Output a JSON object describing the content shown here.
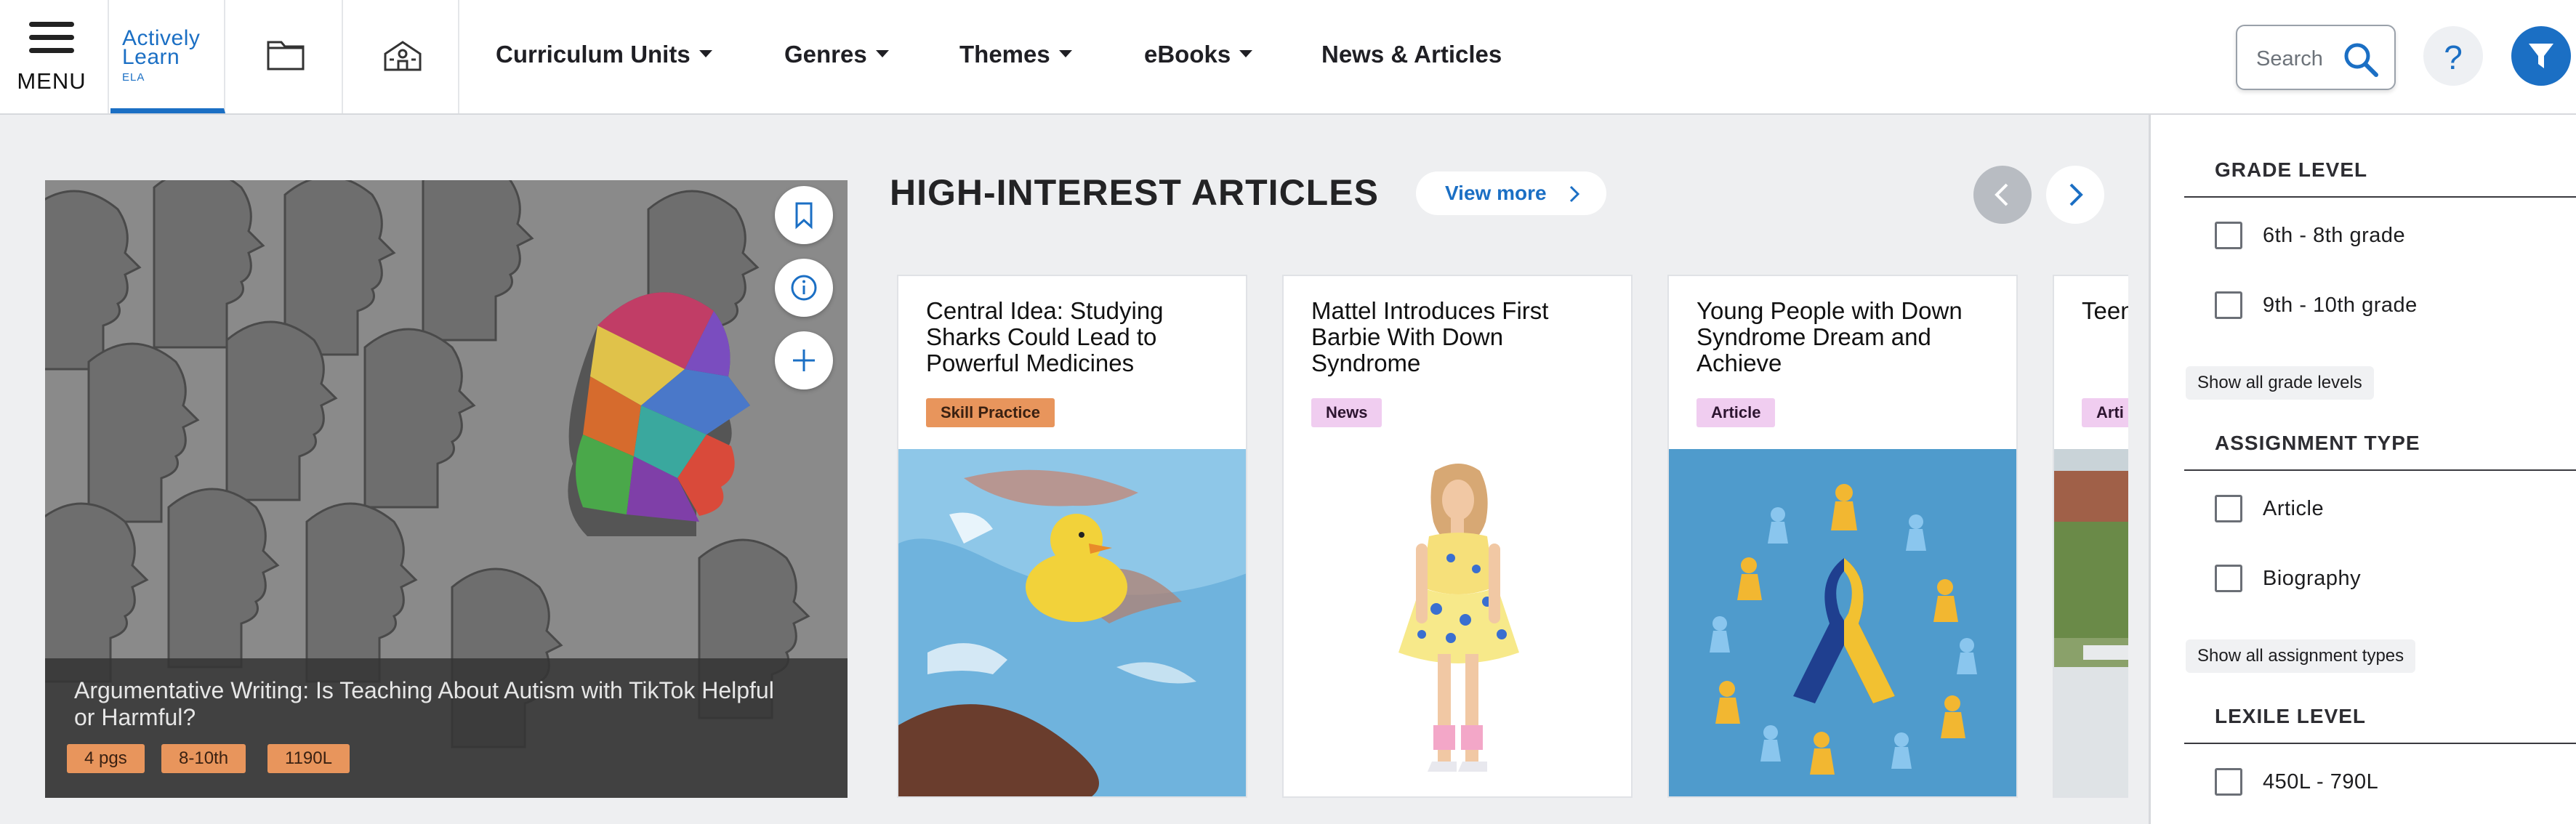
{
  "header": {
    "menu_label": "MENU",
    "logo": {
      "line1": "Actively",
      "line2": "Learn",
      "line3": "ELA"
    },
    "nav": [
      {
        "label": "Curriculum Units",
        "has_dropdown": true
      },
      {
        "label": "Genres",
        "has_dropdown": true
      },
      {
        "label": "Themes",
        "has_dropdown": true
      },
      {
        "label": "eBooks",
        "has_dropdown": true
      },
      {
        "label": "News & Articles",
        "has_dropdown": false
      }
    ],
    "search": {
      "placeholder": "Search",
      "value": ""
    },
    "help_label": "?",
    "icons": {
      "library": "folder-icon",
      "school": "school-icon",
      "search": "search-icon",
      "filter": "filter-icon"
    }
  },
  "featured": {
    "title": "Argumentative Writing: Is Teaching About Autism with TikTok Helpful or Harmful?",
    "tags": [
      "4 pgs",
      "8-10th",
      "1190L"
    ],
    "actions": [
      "bookmark-icon",
      "info-icon",
      "add-icon"
    ]
  },
  "section": {
    "title": "HIGH-INTEREST ARTICLES",
    "view_more": "View more"
  },
  "cards": [
    {
      "title": "Central Idea: Studying Sharks Could Lead to Powerful Medicines",
      "tag": "Skill Practice",
      "tag_color": "#e8955c",
      "tag_text_color": "#3a2112"
    },
    {
      "title": "Mattel Introduces First Barbie With Down Syndrome",
      "tag": "News",
      "tag_color": "#f0cdf0",
      "tag_text_color": "#2d1530"
    },
    {
      "title": "Young People with Down Syndrome Dream and Achieve",
      "tag": "Article",
      "tag_color": "#f0cdf0",
      "tag_text_color": "#2d1530"
    },
    {
      "title": "Teen Wish Com",
      "tag": "Arti",
      "tag_color": "#f0cdf0",
      "tag_text_color": "#2d1530"
    }
  ],
  "filters": {
    "grade_level": {
      "title": "GRADE LEVEL",
      "options": [
        "6th - 8th grade",
        "9th - 10th grade"
      ],
      "show_all": "Show all grade levels"
    },
    "assignment_type": {
      "title": "ASSIGNMENT TYPE",
      "options": [
        "Article",
        "Biography"
      ],
      "show_all": "Show all assignment types"
    },
    "lexile_level": {
      "title": "LEXILE LEVEL",
      "options": [
        "450L - 790L"
      ]
    }
  },
  "colors": {
    "brand_blue": "#1b6fc4",
    "background": "#eeeff1",
    "tag_orange": "#e8955c",
    "tag_pink": "#f0cdf0"
  }
}
